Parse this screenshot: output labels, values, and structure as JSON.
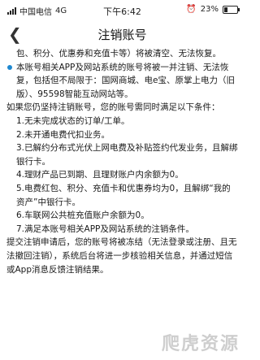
{
  "status_bar": {
    "carrier": "中国电信",
    "network": "4G",
    "time": "下午6:42",
    "battery_percent": "23%"
  },
  "nav": {
    "back_icon": "chevron-left-icon",
    "title": "注销账号"
  },
  "content": {
    "top_fragment": "包、积分、优惠券和充值卡等）将被清空、无法恢复。",
    "bullet_text": "本账号相关APP及网站系统的账号将被一并注销、无法恢复，包括但不局限于：国网商城、电e宝、原掌上电力（旧版）、95598智能互动网站等。",
    "intro": "如果您仍坚持注销账号，您的账号需同时满足以下条件：",
    "conditions": [
      "1.无未完成状态的订单/工单。",
      "2.未开通电费代扣业务。",
      "3.已解约分布式光伏上网电费及补贴签约代发业务，且解绑银行卡。",
      "4.理财产品已到期、且理财账户内余额为0。",
      "5.电费红包、积分、充值卡和优惠券均为0，且解绑“我的资产”中银行卡。",
      "6.车联网公共桩充值账户余额为0。",
      "7.满足本账号相关APP及网站系统的注销条件。"
    ],
    "footer": "提交注销申请后，您的账号将被冻结（无法登录或注册、且无法撤回注销），系统后台将进一步核验相关信息，并通过短信或App消息反馈注销结果。"
  },
  "watermark": "爬虎资源",
  "colors": {
    "bullet": "#1e88d0"
  }
}
